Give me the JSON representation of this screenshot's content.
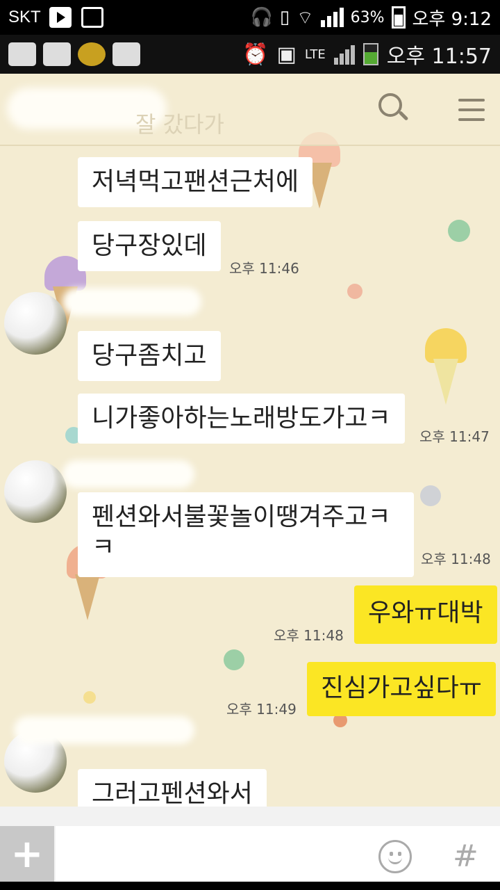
{
  "outer_status": {
    "carrier": "SKT",
    "battery": "63%",
    "time": "오후 9:12"
  },
  "inner_status": {
    "network": "LTE",
    "time": "오후 11:57"
  },
  "header": {
    "subtitle": "잘 갔다가",
    "icons": [
      "search-icon",
      "menu-icon"
    ]
  },
  "messages": [
    {
      "text": "저녁먹고팬션근처에",
      "sender": "other"
    },
    {
      "text": "당구장있데",
      "sender": "other",
      "time": "오후 11:46"
    },
    {
      "text": "당구좀치고",
      "sender": "other"
    },
    {
      "text": "니가좋아하는노래방도가고ㅋ",
      "sender": "other",
      "time": "오후 11:47"
    },
    {
      "text": "펜션와서불꽃놀이땡겨주고ㅋ\nㅋ",
      "sender": "other",
      "time": "오후 11:48"
    },
    {
      "text": "우와ㅠ대박",
      "sender": "me",
      "time": "오후 11:48"
    },
    {
      "text": "진심가고싶다ㅠ",
      "sender": "me",
      "time": "오후 11:49"
    },
    {
      "text": "그러고펜션와서",
      "sender": "other"
    }
  ],
  "input": {
    "plus_label": "+",
    "hash_label": "#"
  },
  "colors": {
    "background": "#f4ecd2",
    "my_bubble": "#fbe624",
    "other_bubble": "#ffffff"
  }
}
